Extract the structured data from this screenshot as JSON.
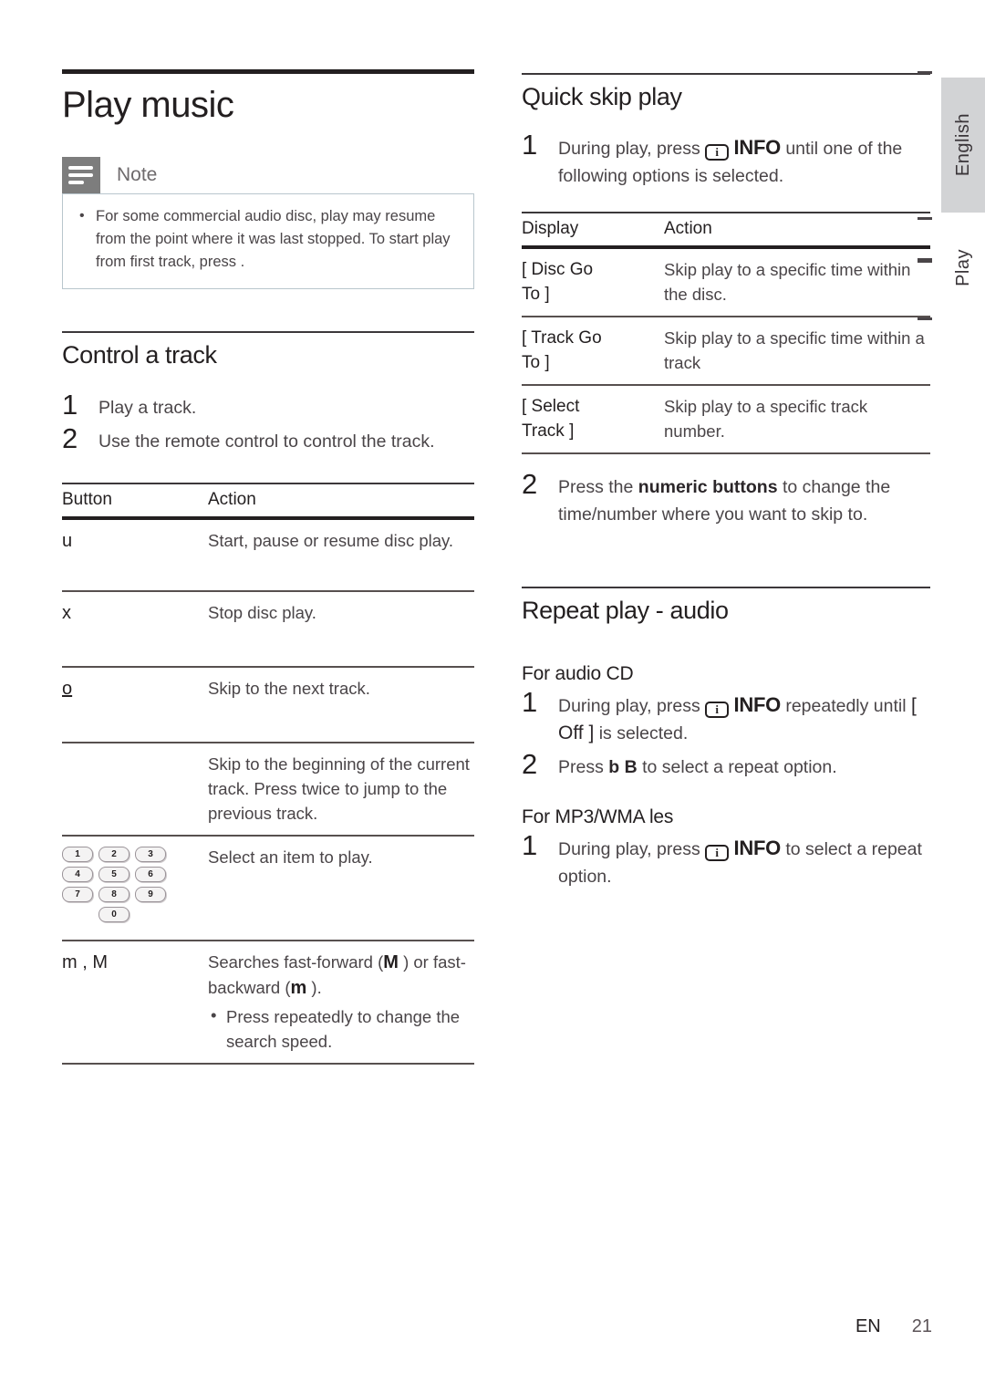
{
  "page": {
    "title": "Play music",
    "footer_lang": "EN",
    "footer_page": "21"
  },
  "side_tabs": {
    "language": "English",
    "section": "Play"
  },
  "note": {
    "label": "Note",
    "icon": "note-lines-icon",
    "items": [
      "For some commercial audio disc, play may resume from the point where it was last stopped. To start play from first track, press  ."
    ]
  },
  "control_a_track": {
    "heading": "Control a track",
    "steps": [
      {
        "num": "1",
        "text": "Play a track."
      },
      {
        "num": "2",
        "text": "Use the remote control to control the track."
      }
    ],
    "table": {
      "headers": [
        "Button",
        "Action"
      ],
      "rows": [
        {
          "button": "u",
          "action": "Start, pause or resume disc play.",
          "sub": []
        },
        {
          "button": "x",
          "action": "Stop disc play.",
          "sub": []
        },
        {
          "button": "o",
          "button_style": "underline",
          "action": "Skip to the next track.",
          "sub": []
        },
        {
          "button": "",
          "action": "Skip to the beginning of the current track. Press twice to jump to the previous track.",
          "sub": []
        },
        {
          "button": "numeric-keypad",
          "action": "Select an item to play.",
          "sub": []
        },
        {
          "button": "m  , M",
          "action_pre": "Searches fast-forward (",
          "action_sym1": "M",
          "action_mid": "  ) or fast-backward (",
          "action_sym2": "m",
          "action_post": "  ).",
          "sub": [
            "Press repeatedly to change the search speed."
          ]
        }
      ]
    },
    "keypad": {
      "rows": [
        [
          "1",
          "2",
          "3"
        ],
        [
          "4",
          "5",
          "6"
        ],
        [
          "7",
          "8",
          "9"
        ]
      ],
      "zero": "0"
    }
  },
  "quick_skip_play": {
    "heading": "Quick skip play",
    "step1": {
      "num": "1",
      "pre": "During play, press ",
      "icon_label": "i",
      "info": "INFO",
      "post": " until one of the following options is selected."
    },
    "table": {
      "headers": [
        "Display",
        "Action"
      ],
      "rows": [
        {
          "display_l1": "[ Disc Go",
          "display_l2": "To ]",
          "action": "Skip play to a specific time within the disc."
        },
        {
          "display_l1": "[ Track Go",
          "display_l2": "To ]",
          "action": "Skip play to a specific time within a track"
        },
        {
          "display_l1": "[ Select",
          "display_l2": "Track ]",
          "action": "Skip play to a specific track number."
        }
      ]
    },
    "step2": {
      "num": "2",
      "pre": "Press the ",
      "bold": "numeric buttons",
      "post": " to change the time/number where you want to skip to."
    }
  },
  "repeat_play_audio": {
    "heading": "Repeat play - audio",
    "audio_cd": {
      "subheading": "For audio CD",
      "step1": {
        "num": "1",
        "pre": "During play, press ",
        "icon_label": "i",
        "info": "INFO",
        "mid": " repeatedly until ",
        "option": "[ Off ]",
        "post": " is selected."
      },
      "step2": {
        "num": "2",
        "pre": "Press ",
        "sym": "b B",
        "post": "  to select a repeat option."
      }
    },
    "mp3_wma": {
      "subheading": "For MP3/WMA  les",
      "step1": {
        "num": "1",
        "pre": "During play, press ",
        "icon_label": "i",
        "info": "INFO",
        "post": " to select a repeat option."
      }
    }
  }
}
